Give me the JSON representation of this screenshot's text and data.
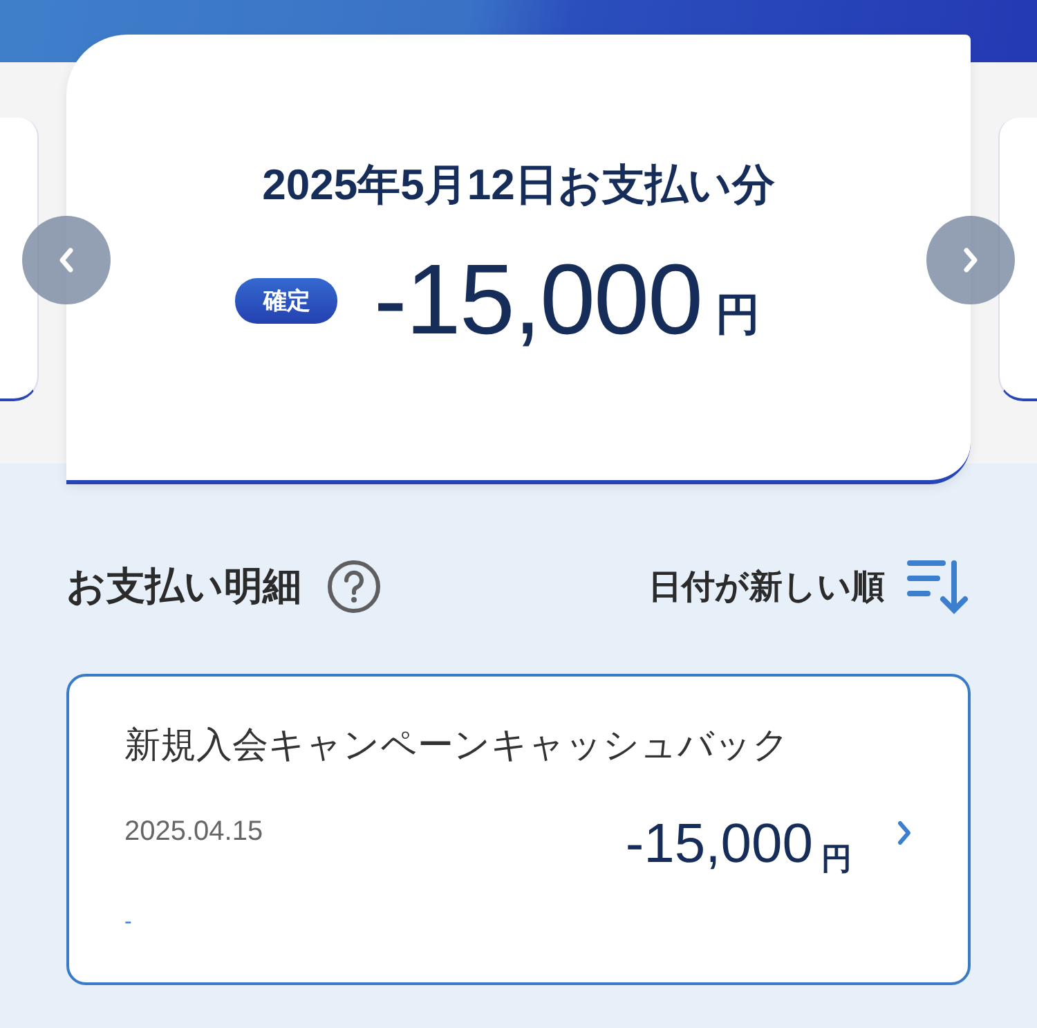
{
  "statement": {
    "title": "2025年5月12日お支払い分",
    "status_badge": "確定",
    "amount": "-15,000",
    "currency": "円"
  },
  "details": {
    "heading": "お支払い明細",
    "sort_label": "日付が新しい順"
  },
  "transactions": [
    {
      "title": "新規入会キャンペーンキャッシュバック",
      "date": "2025.04.15",
      "amount": "-15,000",
      "currency": "円",
      "note": "-"
    }
  ]
}
